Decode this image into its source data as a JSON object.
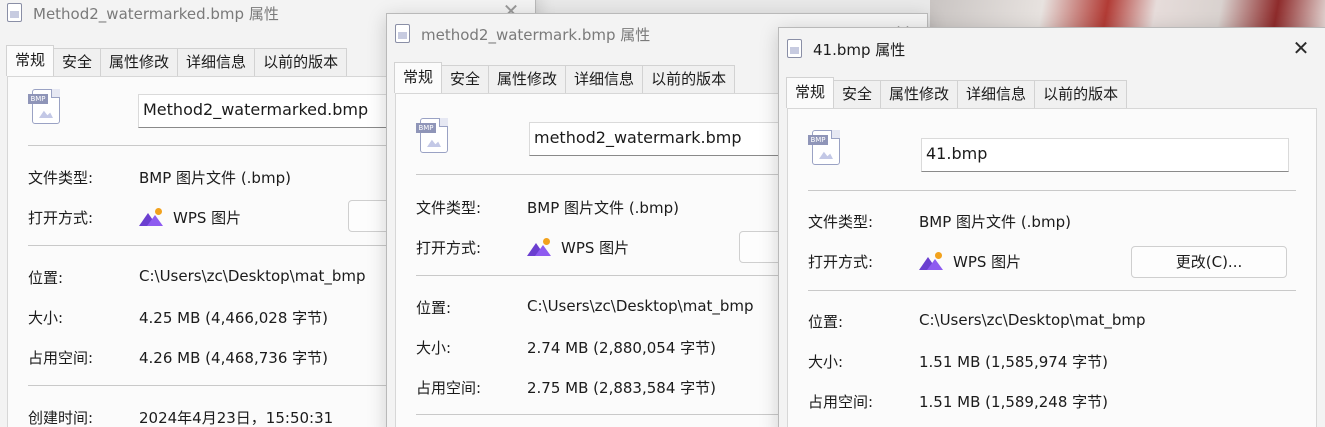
{
  "tabs": [
    "常规",
    "安全",
    "属性修改",
    "详细信息",
    "以前的版本"
  ],
  "labels": {
    "file_type": "文件类型:",
    "opens_with": "打开方式:",
    "location": "位置:",
    "size": "大小:",
    "size_on_disk": "占用空间:",
    "created": "创建时间:"
  },
  "icons": {
    "file": "bmp-file-icon",
    "file_badge": "BMP",
    "app": "wps-picture-icon",
    "close": "close-icon"
  },
  "windows": [
    {
      "title": "Method2_watermarked.bmp 属性",
      "active": false,
      "file_name": "Method2_watermarked.bmp",
      "file_type": "BMP 图片文件 (.bmp)",
      "opens_with": "WPS 图片",
      "change_button": "",
      "location": "C:\\Users\\zc\\Desktop\\mat_bmp",
      "size": "4.25 MB (4,466,028 字节)",
      "size_on_disk": "4.26 MB (4,468,736 字节)",
      "created": "2024年4月23日，15:50:31"
    },
    {
      "title": "method2_watermark.bmp 属性",
      "active": false,
      "file_name": "method2_watermark.bmp",
      "file_type": "BMP 图片文件 (.bmp)",
      "opens_with": "WPS 图片",
      "change_button": "",
      "location": "C:\\Users\\zc\\Desktop\\mat_bmp",
      "size": "2.74 MB (2,880,054 字节)",
      "size_on_disk": "2.75 MB (2,883,584 字节)"
    },
    {
      "title": "41.bmp 属性",
      "active": true,
      "file_name": "41.bmp",
      "file_type": "BMP 图片文件 (.bmp)",
      "opens_with": "WPS 图片",
      "change_button": "更改(C)...",
      "location": "C:\\Users\\zc\\Desktop\\mat_bmp",
      "size": "1.51 MB (1,585,974 字节)",
      "size_on_disk": "1.51 MB (1,589,248 字节)"
    }
  ]
}
